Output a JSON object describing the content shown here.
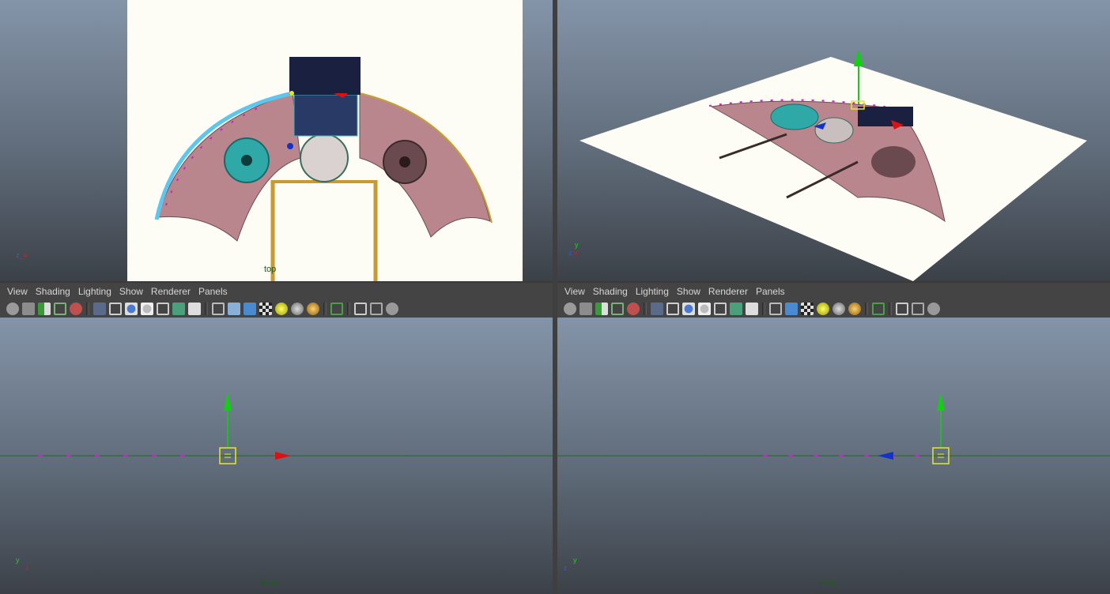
{
  "menus": [
    "View",
    "Shading",
    "Lighting",
    "Show",
    "Renderer",
    "Panels"
  ],
  "viewports": {
    "top": {
      "label": "top"
    },
    "persp": {
      "label": ""
    },
    "front": {
      "label": "front"
    },
    "side": {
      "label": "side"
    }
  },
  "axis": {
    "x": "x",
    "y": "y",
    "z": "z"
  },
  "colors": {
    "bg_top": "#8494a8",
    "bg_bottom": "#3c4148",
    "plane": "#fdfcf5",
    "drape": "#b8868c",
    "teal": "#2fa8a8",
    "cyan_rim": "#5cc7ee",
    "grid_axis": "#1e6b1e",
    "manip_green": "#11d011",
    "manip_red": "#dd1111",
    "manip_blue": "#1133cc",
    "manip_yellow": "#e8e822",
    "curve_magenta": "#cc22cc"
  },
  "toolbar_icons": [
    "select-camera-icon",
    "lock-camera-icon",
    "bookmarks-icon",
    "image-plane-icon",
    "2d-pan-zoom-icon",
    "grease-pencil-icon",
    "grid-icon",
    "film-gate-icon",
    "resolution-gate-icon",
    "gate-mask-icon",
    "field-chart-icon",
    "safe-action-icon",
    "safe-title-icon",
    "wireframe-icon",
    "smooth-shade-icon",
    "shade-wireframe-icon",
    "textured-icon",
    "use-all-lights-icon",
    "shadows-icon",
    "ambient-occlusion-icon",
    "xray-icon",
    "isolate-select-icon",
    "select-xray-icon",
    "multisample-icon",
    "share-icon"
  ]
}
